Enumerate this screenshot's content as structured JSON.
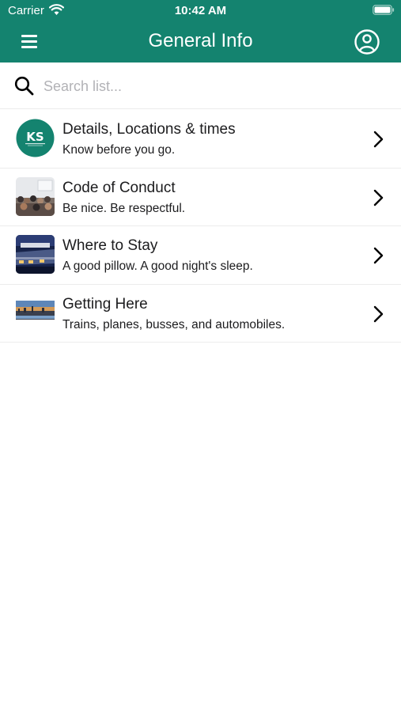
{
  "status_bar": {
    "carrier": "Carrier",
    "time": "10:42 AM"
  },
  "nav": {
    "title": "General Info",
    "menu_icon": "hamburger-menu-icon",
    "profile_icon": "user-circle-icon"
  },
  "search": {
    "placeholder": "Search list...",
    "value": ""
  },
  "list": {
    "items": [
      {
        "title": "Details, Locations & times",
        "subtitle": "Know before you go.",
        "thumbnail": "ks-logo",
        "logo_text": "KS"
      },
      {
        "title": "Code of Conduct",
        "subtitle": "Be nice. Be respectful.",
        "thumbnail": "conference-photo"
      },
      {
        "title": "Where to Stay",
        "subtitle": "A good pillow. A good night's sleep.",
        "thumbnail": "hotel-photo"
      },
      {
        "title": "Getting Here",
        "subtitle": "Trains, planes, busses, and automobiles.",
        "thumbnail": "city-skyline-photo"
      }
    ]
  },
  "colors": {
    "header": "#14836f",
    "divider": "#ececec",
    "placeholder": "#b2b2b6"
  }
}
